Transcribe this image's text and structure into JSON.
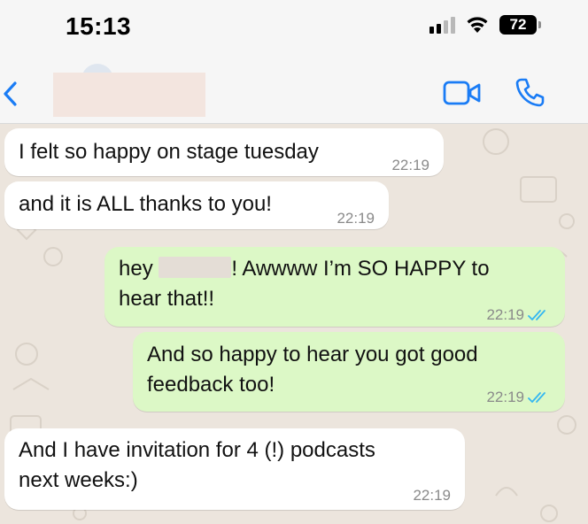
{
  "status_bar": {
    "time": "15:13",
    "battery": "72"
  },
  "header": {
    "contact_name": ""
  },
  "messages": [
    {
      "direction": "in",
      "text": "I felt so happy on stage tuesday",
      "time": "22:19"
    },
    {
      "direction": "in",
      "text": "and it is ALL thanks to you!",
      "time": "22:19"
    },
    {
      "direction": "out",
      "text_before": "hey ",
      "text_after": "! Awwww I’m SO HAPPY to",
      "text_line2": "hear that!!",
      "time": "22:19",
      "status": "read"
    },
    {
      "direction": "out",
      "text_line1": "And so happy to hear you got good",
      "text_line2": "feedback too!",
      "time": "22:19",
      "status": "read"
    },
    {
      "direction": "in",
      "text_line1": "And I have invitation for 4 (!)  podcasts",
      "text_line2": "next weeks:)",
      "time": "22:19"
    }
  ],
  "colors": {
    "accent": "#1a7cf5",
    "incoming_bubble": "#ffffff",
    "outgoing_bubble": "#dcf8c6",
    "chat_background": "#ece5dd",
    "read_ticks": "#34b7f1"
  },
  "icons": [
    "back-chevron-icon",
    "video-call-icon",
    "phone-icon",
    "signal-icon",
    "wifi-icon",
    "battery-icon",
    "read-ticks-icon"
  ]
}
